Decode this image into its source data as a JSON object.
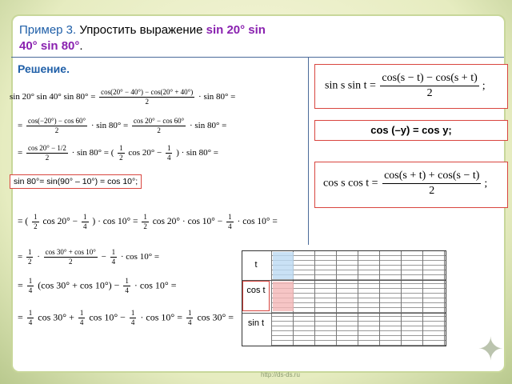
{
  "header": {
    "example_label": "Пример 3.",
    "instruction": " Упростить выражение ",
    "expression_line1": "sin 20° sin",
    "expression_line2": "40° sin 80°",
    "period": "."
  },
  "solution_label": "Решение.",
  "steps": {
    "s1_lhs": "sin 20° sin 40° sin 80° =",
    "s1_num": "cos(20° − 40°) − cos(20° + 40°)",
    "s1_den": "2",
    "s1_tail": "· sin 80° =",
    "s2_num_a": "cos(−20°) − cos 60°",
    "s2_den_a": "2",
    "s2_mid": "· sin 80° =",
    "s2_num_b": "cos 20° − cos 60°",
    "s2_den_b": "2",
    "s2_tail": "· sin 80° =",
    "s3_num_a": "cos 20° −",
    "s3_num_a2": "1/2",
    "s3_den_a": "2",
    "s3_mid": "· sin 80° = (",
    "s3_half": "1",
    "s3_half_d": "2",
    "s3_cos": "cos 20° −",
    "s3_q": "1",
    "s3_q_d": "4",
    "s3_tail": ") · sin 80° =",
    "sin80_identity": "sin 80°= sin(90° – 10°) = cos 10°;",
    "s4_open": "= (",
    "s4_cos": "cos 20° −",
    "s4_close": ") · cos 10° =",
    "s4_cos2": "cos 20° · cos 10° −",
    "s4_tail": "· cos 10° =",
    "s5_num": "cos 30° + cos 10°",
    "s5_den": "2",
    "s5_tail": "· cos 10° =",
    "s6_open": "(cos 30° + cos 10°) −",
    "s6_tail": "· cos 10° =",
    "s7_cos30": "cos 30° +",
    "s7_cos10": "cos 10° −",
    "s7_mid": "· cos 10° =",
    "s7_end": "cos 30° =",
    "eq": "="
  },
  "formulas": {
    "f1_lhs": "sin s sin t =",
    "f1_num": "cos(s − t) − cos(s + t)",
    "f1_den": "2",
    "f1_end": ";",
    "f2": "cos (–y) = cos y;",
    "f3_lhs": "cos s cos t =",
    "f3_num": "cos(s + t) + cos(s − t)",
    "f3_den": "2",
    "f3_end": ";"
  },
  "table": {
    "rows": [
      "t",
      "cos t",
      "sin t"
    ]
  },
  "watermark": "http://ds-ds.ru",
  "colors": {
    "accent_blue": "#1f5fa8",
    "accent_purple": "#8a22b0",
    "box_red": "#d9453f",
    "cell_blue": "#bcd9f2",
    "cell_pink": "#f4b7b7"
  }
}
